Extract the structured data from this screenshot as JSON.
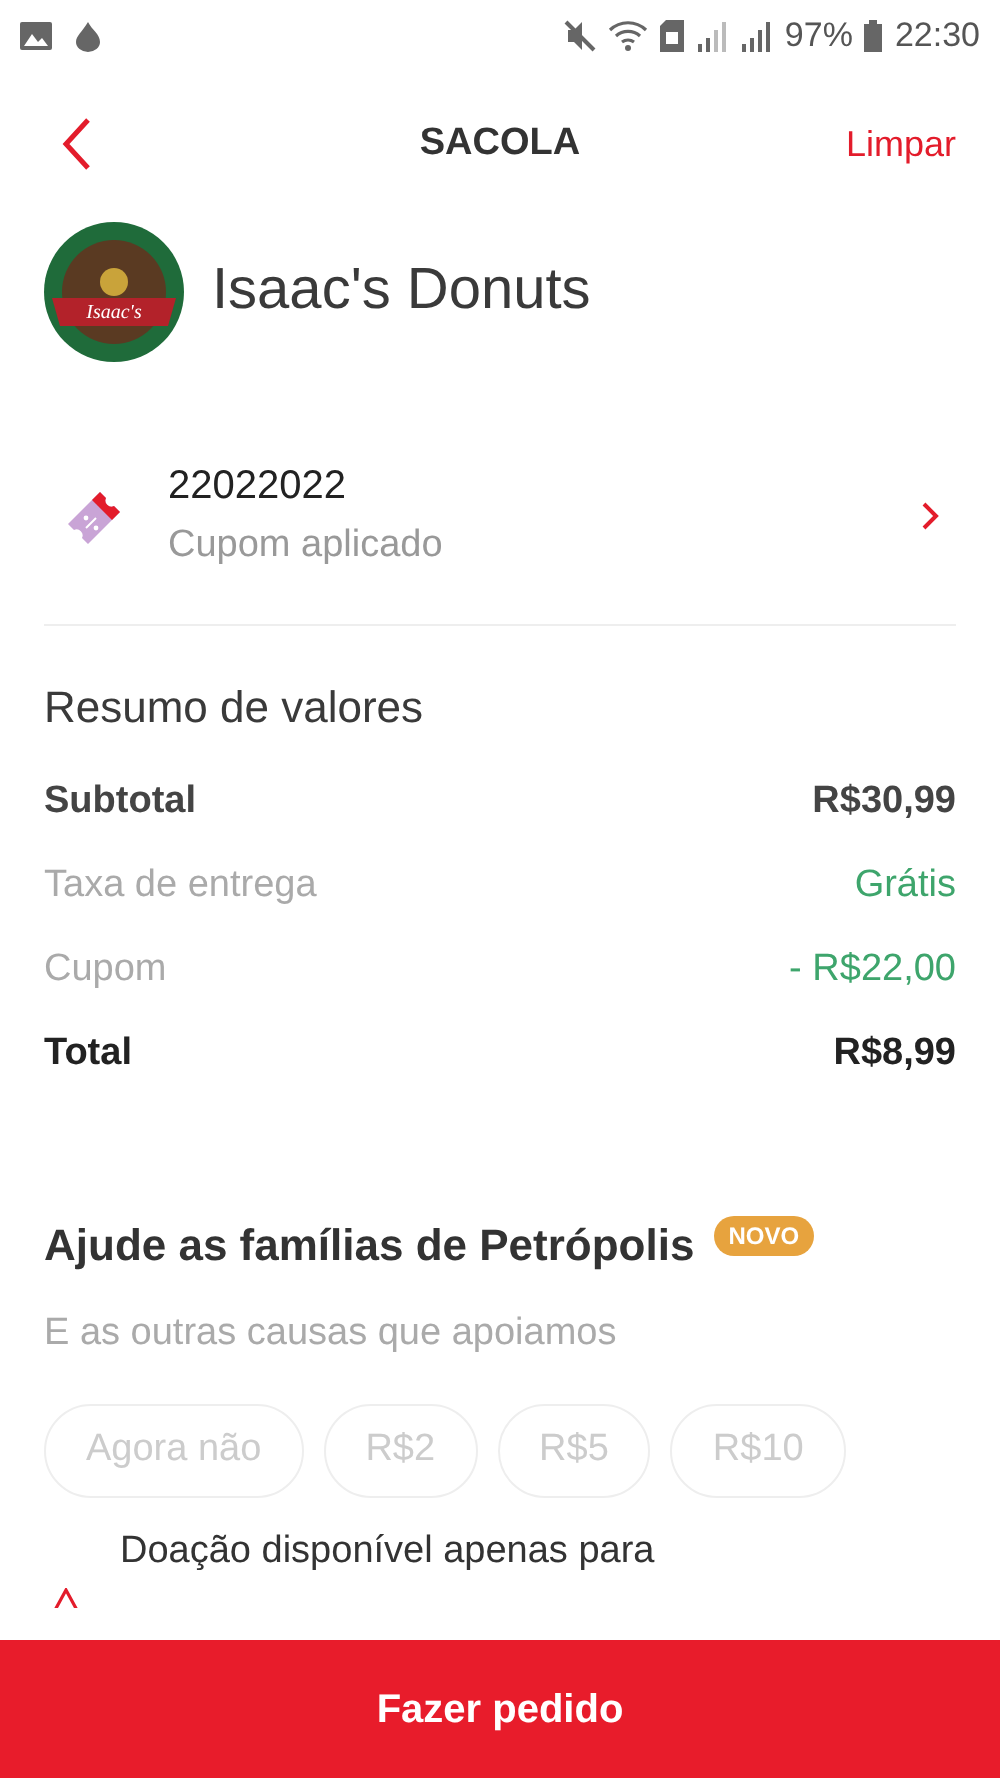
{
  "status_bar": {
    "battery": "97%",
    "time": "22:30"
  },
  "header": {
    "title": "SACOLA",
    "action": "Limpar"
  },
  "store": {
    "name": "Isaac's Donuts",
    "logo_text": "Isaac's"
  },
  "coupon": {
    "code": "22022022",
    "status": "Cupom aplicado"
  },
  "summary": {
    "title": "Resumo de valores",
    "rows": [
      {
        "label": "Subtotal",
        "value": "R$30,99",
        "kind": "strong"
      },
      {
        "label": "Taxa de entrega",
        "value": "Grátis",
        "kind": "discount"
      },
      {
        "label": "Cupom",
        "value": "- R$22,00",
        "kind": "discount"
      },
      {
        "label": "Total",
        "value": "R$8,99",
        "kind": "total"
      }
    ]
  },
  "donation": {
    "title": "Ajude as famílias de Petrópolis",
    "badge": "NOVO",
    "subtitle": "E as outras causas que apoiamos",
    "options": [
      {
        "label": "Agora não",
        "disabled": true
      },
      {
        "label": "R$2",
        "disabled": true
      },
      {
        "label": "R$5",
        "disabled": true
      },
      {
        "label": "R$10",
        "disabled": true
      }
    ],
    "notice": "Doação disponível apenas para"
  },
  "primary_button": "Fazer pedido"
}
